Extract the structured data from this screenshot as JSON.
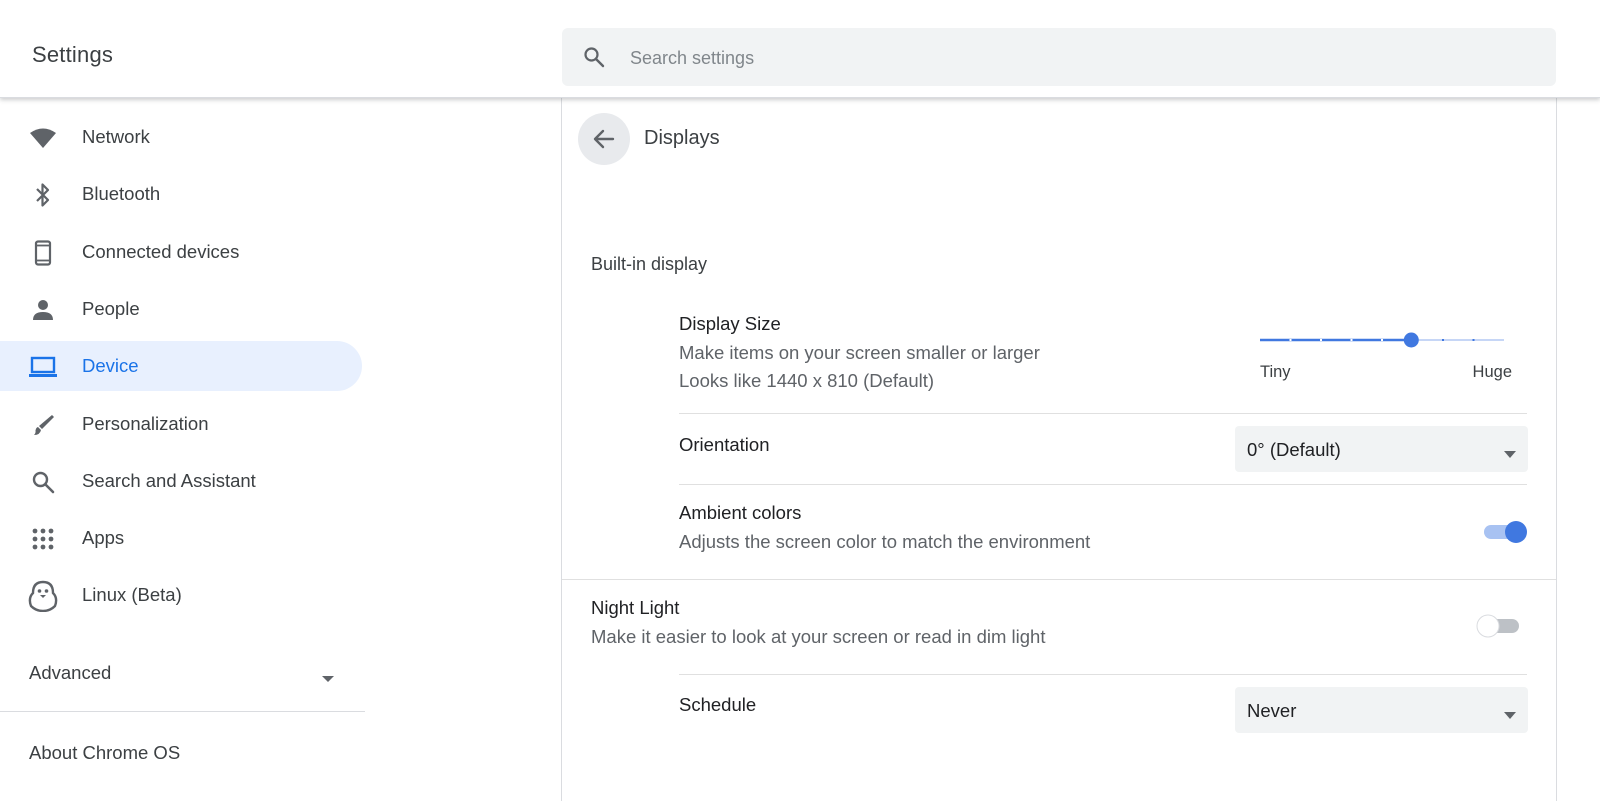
{
  "header": {
    "title": "Settings",
    "search_placeholder": "Search settings",
    "search_icon": "search-icon"
  },
  "sidebar": {
    "items": [
      {
        "label": "Network",
        "icon": "wifi-icon"
      },
      {
        "label": "Bluetooth",
        "icon": "bluetooth-icon"
      },
      {
        "label": "Connected devices",
        "icon": "phone-icon"
      },
      {
        "label": "People",
        "icon": "person-icon"
      },
      {
        "label": "Device",
        "icon": "laptop-icon",
        "active": true
      },
      {
        "label": "Personalization",
        "icon": "brush-icon"
      },
      {
        "label": "Search and Assistant",
        "icon": "search-icon"
      },
      {
        "label": "Apps",
        "icon": "apps-grid-icon"
      },
      {
        "label": "Linux (Beta)",
        "icon": "penguin-icon"
      }
    ],
    "advanced_label": "Advanced",
    "about_label": "About Chrome OS"
  },
  "main": {
    "page_title": "Displays",
    "builtin_section": "Built-in display",
    "display_size": {
      "title": "Display Size",
      "subtitle": "Make items on your screen smaller or larger",
      "detail": "Looks like 1440 x 810 (Default)",
      "min_label": "Tiny",
      "max_label": "Huge",
      "level_fraction": 0.62
    },
    "orientation": {
      "title": "Orientation",
      "value": "0° (Default)"
    },
    "ambient": {
      "title": "Ambient colors",
      "subtitle": "Adjusts the screen color to match the environment",
      "enabled": true
    },
    "night_light": {
      "title": "Night Light",
      "subtitle": "Make it easier to look at your screen or read in dim light",
      "enabled": false
    },
    "schedule": {
      "title": "Schedule",
      "value": "Never"
    }
  },
  "colors": {
    "accent": "#1a73e8",
    "active_bg": "#e8f0fe",
    "slider_blue": "#4078e0"
  }
}
